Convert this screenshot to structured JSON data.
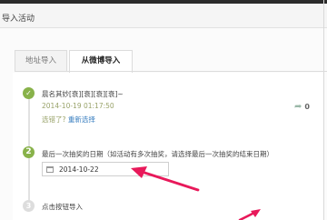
{
  "dialog": {
    "title": "导入活动"
  },
  "tabs": [
    {
      "label": "地址导入",
      "active": false
    },
    {
      "label": "从微博导入",
      "active": true
    }
  ],
  "steps": {
    "step1": {
      "number": "✓",
      "post_title": "晨名其妙[衰][衰][衰][衰]~",
      "post_time": "2014-10-19 01:17:50",
      "select_prefix": "选错了?",
      "reselect_link": "重新选择",
      "share_count": "0"
    },
    "step2": {
      "number": "2",
      "label": "最后一次抽奖的日期（如活动有多次抽奖，请选择最后一次抽奖的结束日期）",
      "date_value": "2014-10-22"
    },
    "step3": {
      "number": "3",
      "label": "点击按钮导入"
    }
  },
  "colors": {
    "accent_green": "#88b24a",
    "link_blue": "#3a7fc0",
    "annotation_red": "#e8195a"
  },
  "icons": {
    "share": "share-arrow-icon",
    "calendar": "calendar-icon"
  }
}
